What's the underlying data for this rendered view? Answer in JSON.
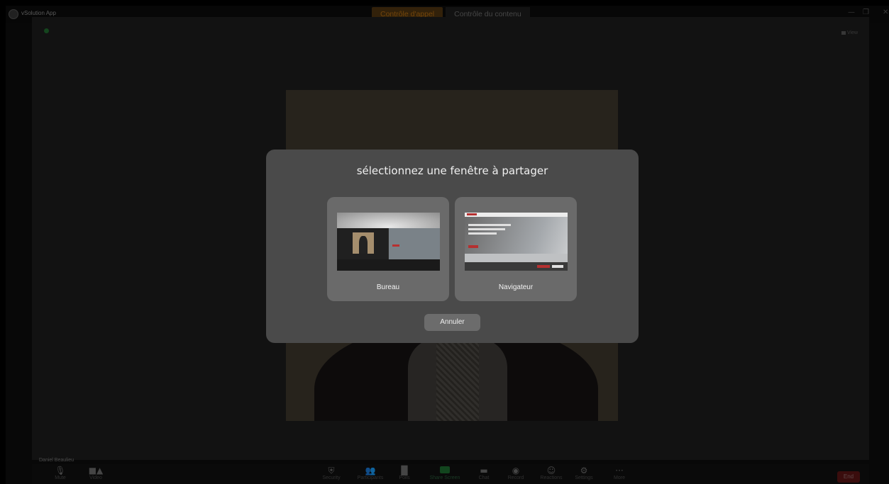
{
  "window": {
    "app_title": "vSolution App",
    "tabs": [
      {
        "label": "Contrôle d'appel",
        "active": true
      },
      {
        "label": "Contrôle du contenu",
        "active": false
      }
    ],
    "controls": {
      "minimize": "—",
      "restore": "❐",
      "close": "✕"
    },
    "accent_color": "#b06a12"
  },
  "meeting": {
    "view_label": "View",
    "participant_name": "Daniel Beaulieu"
  },
  "toolbar": {
    "mute_label": "Mute",
    "video_label": "Video",
    "items": [
      {
        "label": "Security",
        "icon": "shield-icon"
      },
      {
        "label": "Participants",
        "icon": "participants-icon"
      },
      {
        "label": "Polls",
        "icon": "polls-icon"
      },
      {
        "label": "Share Screen",
        "icon": "share-screen-icon"
      },
      {
        "label": "Chat",
        "icon": "chat-icon"
      },
      {
        "label": "Record",
        "icon": "record-icon"
      },
      {
        "label": "Reactions",
        "icon": "reactions-icon"
      },
      {
        "label": "Settings",
        "icon": "settings-icon"
      },
      {
        "label": "More",
        "icon": "more-icon"
      }
    ],
    "end_label": "End",
    "end_color": "#5a1414"
  },
  "dialog": {
    "title": "sélectionnez une fenêtre à partager",
    "options": [
      {
        "label": "Bureau"
      },
      {
        "label": "Navigateur"
      }
    ],
    "cancel_label": "Annuler"
  }
}
